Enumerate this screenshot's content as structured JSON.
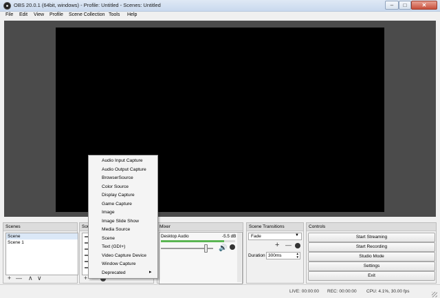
{
  "window": {
    "title": "OBS 20.0.1 (64bit, windows) - Profile: Untitled - Scenes: Untitled",
    "minimize_glyph": "–",
    "maximize_glyph": "□",
    "close_glyph": "✕"
  },
  "menubar": [
    "File",
    "Edit",
    "View",
    "Profile",
    "Scene Collection",
    "Tools",
    "Help"
  ],
  "scenes": {
    "header": "Scenes",
    "items": [
      "Scene",
      "Scene 1"
    ],
    "toolbar": [
      "+",
      "—",
      "∧",
      "∨"
    ]
  },
  "sources": {
    "header": "Sou"
  },
  "mixer": {
    "header": "Mixer",
    "channel_name": "Desktop Audio",
    "db_label": "-5.5 dB",
    "volume_level": 0.85
  },
  "transitions": {
    "header": "Scene Transitions",
    "selected": "Fade",
    "duration_label": "Duration",
    "duration_value": "300ms",
    "toolbar": [
      "+",
      "—"
    ]
  },
  "controls": {
    "header": "Controls",
    "buttons": [
      "Start Streaming",
      "Start Recording",
      "Studio Mode",
      "Settings",
      "Exit"
    ]
  },
  "context_menu": {
    "items": [
      "Audio Input Capture",
      "Audio Output Capture",
      "BrowserSource",
      "Color Source",
      "Display Capture",
      "Game Capture",
      "Image",
      "Image Slide Show",
      "Media Source",
      "Scene",
      "Text (GDI+)",
      "Video Capture Device",
      "Window Capture",
      "Deprecated"
    ],
    "submenu_arrow": "▸"
  },
  "statusbar": {
    "live": "LIVE: 00:00:00",
    "rec": "REC: 00:00:00",
    "cpu": "CPU: 4.1%, 30.00 fps"
  },
  "colors": {
    "preview_bg": "#4b4b4b",
    "canvas": "#000000"
  }
}
